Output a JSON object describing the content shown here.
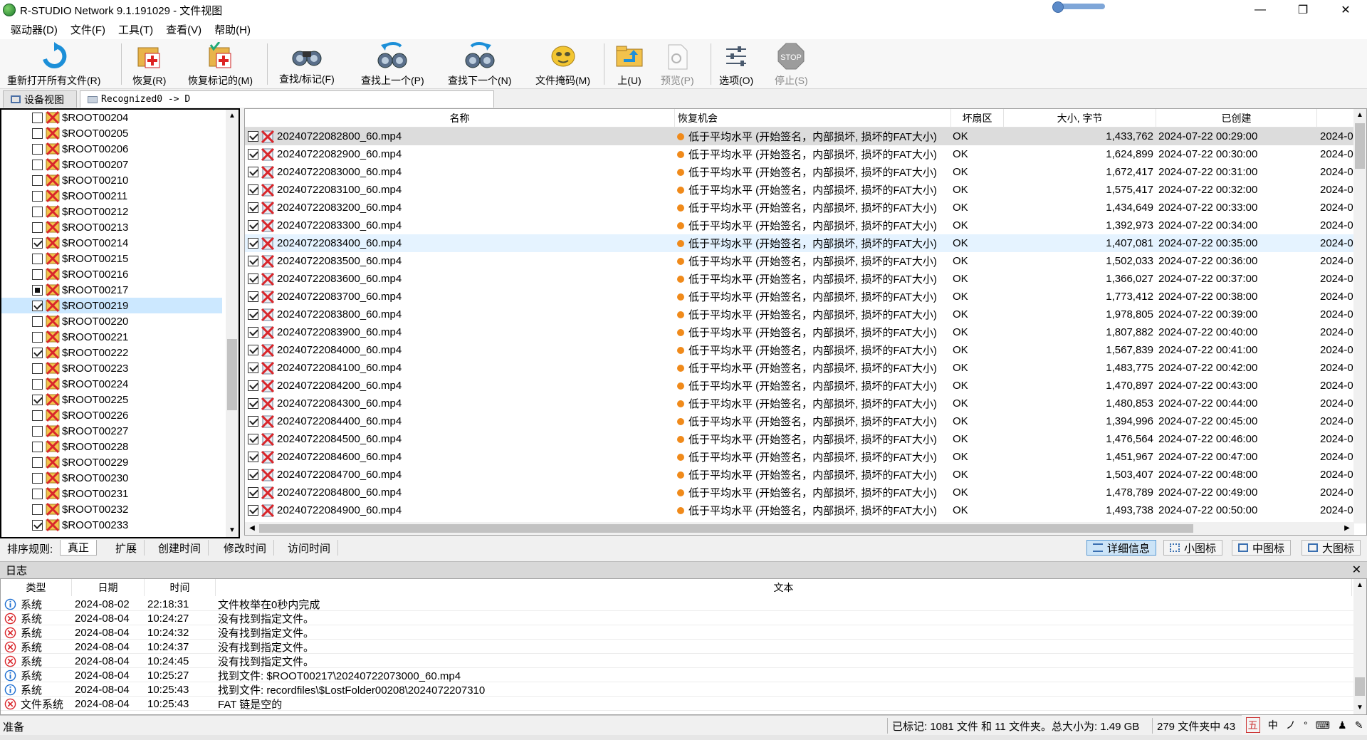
{
  "window": {
    "title": "R-STUDIO Network 9.1.191029 - 文件视图"
  },
  "menu": [
    "驱动器(D)",
    "文件(F)",
    "工具(T)",
    "查看(V)",
    "帮助(H)"
  ],
  "toolbar": {
    "reopen": "重新打开所有文件(R)",
    "recover": "恢复(R)",
    "recover_marked": "恢复标记的(M)",
    "find_mark": "查找/标记(F)",
    "find_prev": "查找上一个(P)",
    "find_next": "查找下一个(N)",
    "file_mask": "文件掩码(M)",
    "up": "上(U)",
    "preview": "预览(P)",
    "options": "选项(O)",
    "stop": "停止(S)",
    "stop_icon_text": "STOP"
  },
  "tabs": {
    "device_view": "设备视图",
    "recognized": "Recognized0 -> D"
  },
  "tree": [
    {
      "label": "$ROOT00204",
      "state": "unchecked"
    },
    {
      "label": "$ROOT00205",
      "state": "unchecked"
    },
    {
      "label": "$ROOT00206",
      "state": "unchecked"
    },
    {
      "label": "$ROOT00207",
      "state": "unchecked"
    },
    {
      "label": "$ROOT00210",
      "state": "unchecked"
    },
    {
      "label": "$ROOT00211",
      "state": "unchecked"
    },
    {
      "label": "$ROOT00212",
      "state": "unchecked"
    },
    {
      "label": "$ROOT00213",
      "state": "unchecked"
    },
    {
      "label": "$ROOT00214",
      "state": "checked"
    },
    {
      "label": "$ROOT00215",
      "state": "unchecked"
    },
    {
      "label": "$ROOT00216",
      "state": "unchecked"
    },
    {
      "label": "$ROOT00217",
      "state": "partial"
    },
    {
      "label": "$ROOT00219",
      "state": "checked"
    },
    {
      "label": "$ROOT00220",
      "state": "unchecked"
    },
    {
      "label": "$ROOT00221",
      "state": "unchecked"
    },
    {
      "label": "$ROOT00222",
      "state": "checked"
    },
    {
      "label": "$ROOT00223",
      "state": "unchecked"
    },
    {
      "label": "$ROOT00224",
      "state": "unchecked"
    },
    {
      "label": "$ROOT00225",
      "state": "checked"
    },
    {
      "label": "$ROOT00226",
      "state": "unchecked"
    },
    {
      "label": "$ROOT00227",
      "state": "unchecked"
    },
    {
      "label": "$ROOT00228",
      "state": "unchecked"
    },
    {
      "label": "$ROOT00229",
      "state": "unchecked"
    },
    {
      "label": "$ROOT00230",
      "state": "unchecked"
    },
    {
      "label": "$ROOT00231",
      "state": "unchecked"
    },
    {
      "label": "$ROOT00232",
      "state": "unchecked"
    },
    {
      "label": "$ROOT00233",
      "state": "checked"
    }
  ],
  "tree_selected_index": 12,
  "files": {
    "columns": [
      "名称",
      "恢复机会",
      "坏扇区",
      "大小, 字节",
      "已创建"
    ],
    "rows": [
      {
        "name": "20240722082800_60.mp4",
        "chance": "低于平均水平 (开始签名，内部损坏, 损坏的FAT大小)",
        "bad": "OK",
        "size": "1,433,762",
        "created": "2024-07-22 00:29:00",
        "extra": "2024-0"
      },
      {
        "name": "20240722082900_60.mp4",
        "chance": "低于平均水平 (开始签名，内部损坏, 损坏的FAT大小)",
        "bad": "OK",
        "size": "1,624,899",
        "created": "2024-07-22 00:30:00",
        "extra": "2024-0"
      },
      {
        "name": "20240722083000_60.mp4",
        "chance": "低于平均水平 (开始签名，内部损坏, 损坏的FAT大小)",
        "bad": "OK",
        "size": "1,672,417",
        "created": "2024-07-22 00:31:00",
        "extra": "2024-0"
      },
      {
        "name": "20240722083100_60.mp4",
        "chance": "低于平均水平 (开始签名，内部损坏, 损坏的FAT大小)",
        "bad": "OK",
        "size": "1,575,417",
        "created": "2024-07-22 00:32:00",
        "extra": "2024-0"
      },
      {
        "name": "20240722083200_60.mp4",
        "chance": "低于平均水平 (开始签名，内部损坏, 损坏的FAT大小)",
        "bad": "OK",
        "size": "1,434,649",
        "created": "2024-07-22 00:33:00",
        "extra": "2024-0"
      },
      {
        "name": "20240722083300_60.mp4",
        "chance": "低于平均水平 (开始签名，内部损坏, 损坏的FAT大小)",
        "bad": "OK",
        "size": "1,392,973",
        "created": "2024-07-22 00:34:00",
        "extra": "2024-0"
      },
      {
        "name": "20240722083400_60.mp4",
        "chance": "低于平均水平 (开始签名，内部损坏, 损坏的FAT大小)",
        "bad": "OK",
        "size": "1,407,081",
        "created": "2024-07-22 00:35:00",
        "extra": "2024-0"
      },
      {
        "name": "20240722083500_60.mp4",
        "chance": "低于平均水平 (开始签名，内部损坏, 损坏的FAT大小)",
        "bad": "OK",
        "size": "1,502,033",
        "created": "2024-07-22 00:36:00",
        "extra": "2024-0"
      },
      {
        "name": "20240722083600_60.mp4",
        "chance": "低于平均水平 (开始签名，内部损坏, 损坏的FAT大小)",
        "bad": "OK",
        "size": "1,366,027",
        "created": "2024-07-22 00:37:00",
        "extra": "2024-0"
      },
      {
        "name": "20240722083700_60.mp4",
        "chance": "低于平均水平 (开始签名，内部损坏, 损坏的FAT大小)",
        "bad": "OK",
        "size": "1,773,412",
        "created": "2024-07-22 00:38:00",
        "extra": "2024-0"
      },
      {
        "name": "20240722083800_60.mp4",
        "chance": "低于平均水平 (开始签名，内部损坏, 损坏的FAT大小)",
        "bad": "OK",
        "size": "1,978,805",
        "created": "2024-07-22 00:39:00",
        "extra": "2024-0"
      },
      {
        "name": "20240722083900_60.mp4",
        "chance": "低于平均水平 (开始签名，内部损坏, 损坏的FAT大小)",
        "bad": "OK",
        "size": "1,807,882",
        "created": "2024-07-22 00:40:00",
        "extra": "2024-0"
      },
      {
        "name": "20240722084000_60.mp4",
        "chance": "低于平均水平 (开始签名，内部损坏, 损坏的FAT大小)",
        "bad": "OK",
        "size": "1,567,839",
        "created": "2024-07-22 00:41:00",
        "extra": "2024-0"
      },
      {
        "name": "20240722084100_60.mp4",
        "chance": "低于平均水平 (开始签名，内部损坏, 损坏的FAT大小)",
        "bad": "OK",
        "size": "1,483,775",
        "created": "2024-07-22 00:42:00",
        "extra": "2024-0"
      },
      {
        "name": "20240722084200_60.mp4",
        "chance": "低于平均水平 (开始签名，内部损坏, 损坏的FAT大小)",
        "bad": "OK",
        "size": "1,470,897",
        "created": "2024-07-22 00:43:00",
        "extra": "2024-0"
      },
      {
        "name": "20240722084300_60.mp4",
        "chance": "低于平均水平 (开始签名，内部损坏, 损坏的FAT大小)",
        "bad": "OK",
        "size": "1,480,853",
        "created": "2024-07-22 00:44:00",
        "extra": "2024-0"
      },
      {
        "name": "20240722084400_60.mp4",
        "chance": "低于平均水平 (开始签名，内部损坏, 损坏的FAT大小)",
        "bad": "OK",
        "size": "1,394,996",
        "created": "2024-07-22 00:45:00",
        "extra": "2024-0"
      },
      {
        "name": "20240722084500_60.mp4",
        "chance": "低于平均水平 (开始签名，内部损坏, 损坏的FAT大小)",
        "bad": "OK",
        "size": "1,476,564",
        "created": "2024-07-22 00:46:00",
        "extra": "2024-0"
      },
      {
        "name": "20240722084600_60.mp4",
        "chance": "低于平均水平 (开始签名，内部损坏, 损坏的FAT大小)",
        "bad": "OK",
        "size": "1,451,967",
        "created": "2024-07-22 00:47:00",
        "extra": "2024-0"
      },
      {
        "name": "20240722084700_60.mp4",
        "chance": "低于平均水平 (开始签名，内部损坏, 损坏的FAT大小)",
        "bad": "OK",
        "size": "1,503,407",
        "created": "2024-07-22 00:48:00",
        "extra": "2024-0"
      },
      {
        "name": "20240722084800_60.mp4",
        "chance": "低于平均水平 (开始签名，内部损坏, 损坏的FAT大小)",
        "bad": "OK",
        "size": "1,478,789",
        "created": "2024-07-22 00:49:00",
        "extra": "2024-0"
      },
      {
        "name": "20240722084900_60.mp4",
        "chance": "低于平均水平 (开始签名，内部损坏, 损坏的FAT大小)",
        "bad": "OK",
        "size": "1,493,738",
        "created": "2024-07-22 00:50:00",
        "extra": "2024-0"
      }
    ],
    "highlight_index": 0,
    "selected_index": 6
  },
  "sort": {
    "label": "排序规则:",
    "tabs": [
      "真正",
      "扩展",
      "创建时间",
      "修改时间",
      "访问时间"
    ]
  },
  "views": [
    "详细信息",
    "小图标",
    "中图标",
    "大图标"
  ],
  "log": {
    "title": "日志",
    "columns": [
      "类型",
      "日期",
      "时间",
      "文本"
    ],
    "rows": [
      {
        "icon": "info",
        "type": "系统",
        "date": "2024-08-02",
        "time": "22:18:31",
        "text": "文件枚举在0秒内完成"
      },
      {
        "icon": "error",
        "type": "系统",
        "date": "2024-08-04",
        "time": "10:24:27",
        "text": "没有找到指定文件。"
      },
      {
        "icon": "error",
        "type": "系统",
        "date": "2024-08-04",
        "time": "10:24:32",
        "text": "没有找到指定文件。"
      },
      {
        "icon": "error",
        "type": "系统",
        "date": "2024-08-04",
        "time": "10:24:37",
        "text": "没有找到指定文件。"
      },
      {
        "icon": "error",
        "type": "系统",
        "date": "2024-08-04",
        "time": "10:24:45",
        "text": "没有找到指定文件。"
      },
      {
        "icon": "info",
        "type": "系统",
        "date": "2024-08-04",
        "time": "10:25:27",
        "text": "找到文件: $ROOT00217\\20240722073000_60.mp4"
      },
      {
        "icon": "info",
        "type": "系统",
        "date": "2024-08-04",
        "time": "10:25:43",
        "text": "找到文件: recordfiles\\$LostFolder00208\\2024072207310"
      },
      {
        "icon": "error",
        "type": "文件系统",
        "date": "2024-08-04",
        "time": "10:25:43",
        "text": "FAT 链是空的"
      }
    ]
  },
  "status": {
    "ready": "准备",
    "marked": "已标记: 1081 文件 和 11 文件夹。总大小为: 1.49 GB",
    "count": "279 文件夹中 43"
  },
  "tray": [
    "五",
    "中",
    "ノ",
    "°",
    "⌨",
    "♟",
    "✎"
  ],
  "colors": {
    "accent": "#0078d7",
    "orange_dot": "#f08a1a",
    "error": "#d9262b",
    "info": "#1f6fd1"
  }
}
